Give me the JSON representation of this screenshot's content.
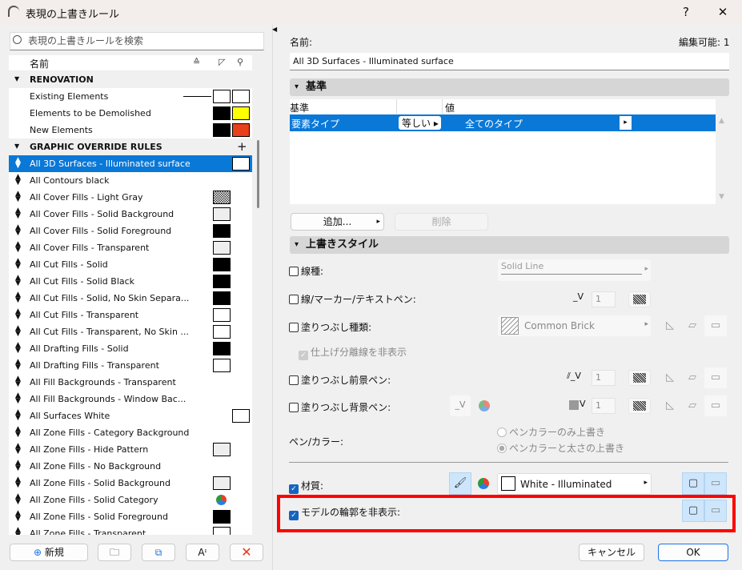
{
  "window": {
    "title": "表現の上書きルール",
    "help": "?",
    "close": "✕"
  },
  "search": {
    "placeholder": "表現の上書きルールを検索"
  },
  "list": {
    "header": {
      "name": "名前"
    },
    "renovation": {
      "label": "RENOVATION",
      "items": [
        {
          "label": "Existing Elements",
          "c1": "#ffffff",
          "c2": "#ffffff",
          "line": true
        },
        {
          "label": "Elements to be Demolished",
          "c1": "#000000",
          "c2": "#ffff00"
        },
        {
          "label": "New Elements",
          "c1": "#000000",
          "c2": "#e8401a"
        }
      ]
    },
    "rules": {
      "label": "GRAPHIC OVERRIDE RULES",
      "add": "+",
      "items": [
        {
          "label": "All 3D Surfaces - Illuminated surface",
          "c2": "#ffffff",
          "selected": true
        },
        {
          "label": "All Contours black"
        },
        {
          "label": "All Cover Fills - Light Gray",
          "c1": "pattern"
        },
        {
          "label": "All Cover Fills - Solid Background",
          "c1": "#eeeeee"
        },
        {
          "label": "All Cover Fills - Solid Foreground",
          "c1": "#000000"
        },
        {
          "label": "All Cover Fills - Transparent",
          "c1": "#eeeeee"
        },
        {
          "label": "All Cut Fills - Solid",
          "c1": "#000000"
        },
        {
          "label": "All Cut Fills - Solid Black",
          "c1": "#000000"
        },
        {
          "label": "All Cut Fills - Solid, No Skin Separa...",
          "c1": "#000000"
        },
        {
          "label": "All Cut Fills - Transparent",
          "c1": "#ffffff"
        },
        {
          "label": "All Cut Fills - Transparent, No Skin ...",
          "c1": "#ffffff"
        },
        {
          "label": "All Drafting Fills - Solid",
          "c1": "#000000"
        },
        {
          "label": "All Drafting Fills - Transparent",
          "c1": "#ffffff"
        },
        {
          "label": "All Fill Backgrounds - Transparent"
        },
        {
          "label": "All Fill Backgrounds - Window Bac..."
        },
        {
          "label": "All Surfaces White",
          "c2": "#ffffff"
        },
        {
          "label": "All Zone Fills - Category Background"
        },
        {
          "label": "All Zone Fills - Hide Pattern",
          "c1": "#eeeeee"
        },
        {
          "label": "All Zone Fills - No Background"
        },
        {
          "label": "All Zone Fills - Solid Background",
          "c1": "#eeeeee"
        },
        {
          "label": "All Zone Fills - Solid Category",
          "c1": "pie"
        },
        {
          "label": "All Zone Fills - Solid Foreground",
          "c1": "#000000"
        },
        {
          "label": "All Zone Fills - Transparent",
          "c1": "#ffffff"
        }
      ]
    }
  },
  "bottom": {
    "new": "新規"
  },
  "detail": {
    "name_label": "名前:",
    "editable": "編集可能: 1",
    "name_value": "All 3D Surfaces - Illuminated surface",
    "criteria": {
      "title": "基準",
      "col1": "基準",
      "col3": "値",
      "row": {
        "criterion": "要素タイプ",
        "operator": "等しい",
        "value": "全てのタイプ"
      },
      "add": "追加...",
      "delete": "削除"
    },
    "style": {
      "title": "上書きスタイル",
      "line_type": "線種:",
      "line_type_value": "Solid Line",
      "line_pen": "線/マーカー/テキストペン:",
      "pen1": "1",
      "fill_type": "塗りつぶし種類:",
      "fill_value": "Common Brick",
      "hide_sep": "仕上げ分離線を非表示",
      "fill_fg": "塗りつぶし前景ペン:",
      "pen2": "1",
      "fill_bg": "塗りつぶし背景ペン:",
      "pen3": "1",
      "pen_color": "ペン/カラー:",
      "radio1": "ペンカラーのみ上書き",
      "radio2": "ペンカラーと太さの上書き",
      "material": "材質:",
      "material_value": "White - Illuminated",
      "hide_contours": "モデルの輪郭を非表示:"
    }
  },
  "actions": {
    "cancel": "キャンセル",
    "ok": "OK"
  },
  "colors": {
    "accent": "#0a78d7",
    "highlight": "#ff0000"
  }
}
